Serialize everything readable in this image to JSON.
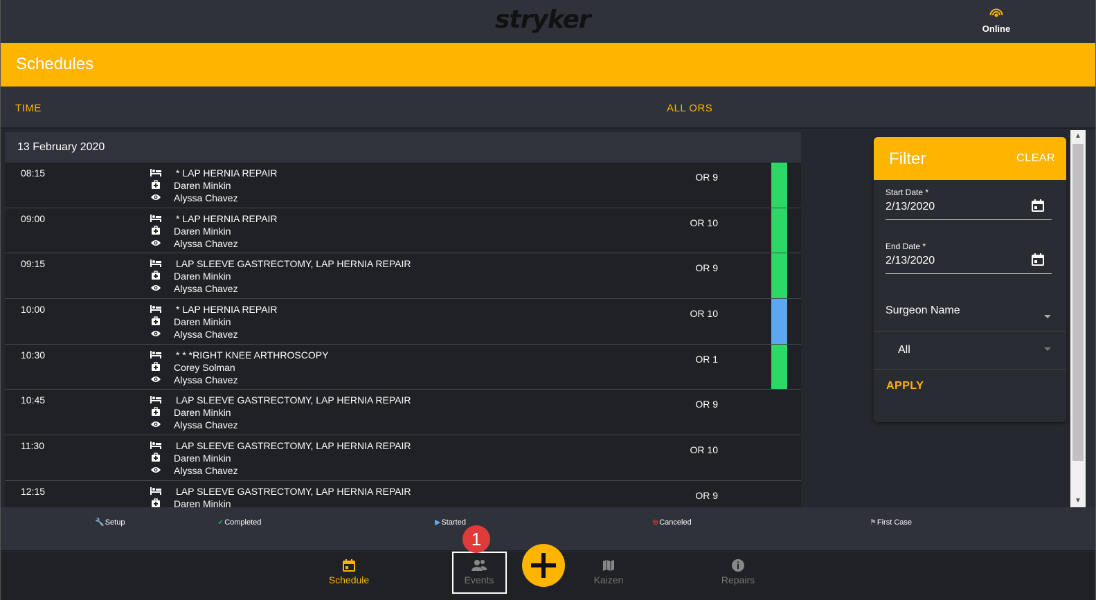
{
  "header": {
    "logo_text": "stryker",
    "status_label": "Online"
  },
  "title": "Schedules",
  "columns": {
    "time": "TIME",
    "ors": "ALL ORS"
  },
  "schedule": {
    "date": "13 February 2020",
    "rows": [
      {
        "time": "08:15",
        "procedure": " * LAP HERNIA REPAIR",
        "surgeon": "Daren Minkin",
        "observer": "Alyssa Chavez",
        "or": "OR 9",
        "status": "completed",
        "status_color": "#2ed866"
      },
      {
        "time": "09:00",
        "procedure": " * LAP HERNIA REPAIR",
        "surgeon": "Daren Minkin",
        "observer": "Alyssa Chavez",
        "or": "OR 10",
        "status": "completed",
        "status_color": "#2ed866"
      },
      {
        "time": "09:15",
        "procedure": "LAP SLEEVE GASTRECTOMY, LAP HERNIA REPAIR",
        "surgeon": "Daren Minkin",
        "observer": "Alyssa Chavez",
        "or": "OR 9",
        "status": "completed",
        "status_color": "#2ed866"
      },
      {
        "time": "10:00",
        "procedure": " * LAP HERNIA REPAIR",
        "surgeon": "Daren Minkin",
        "observer": "Alyssa Chavez",
        "or": "OR 10",
        "status": "started",
        "status_color": "#5aa9f0"
      },
      {
        "time": "10:30",
        "procedure": "* * *RIGHT KNEE ARTHROSCOPY",
        "surgeon": "Corey Solman",
        "observer": "Alyssa Chavez",
        "or": "OR 1",
        "status": "completed",
        "status_color": "#2ed866"
      },
      {
        "time": "10:45",
        "procedure": "LAP SLEEVE GASTRECTOMY, LAP HERNIA REPAIR",
        "surgeon": "Daren Minkin",
        "observer": "Alyssa Chavez",
        "or": "OR 9",
        "status": "none",
        "status_color": ""
      },
      {
        "time": "11:30",
        "procedure": "LAP SLEEVE GASTRECTOMY, LAP HERNIA REPAIR",
        "surgeon": "Daren Minkin",
        "observer": "Alyssa Chavez",
        "or": "OR 10",
        "status": "none",
        "status_color": ""
      },
      {
        "time": "12:15",
        "procedure": "LAP SLEEVE GASTRECTOMY, LAP HERNIA REPAIR",
        "surgeon": "Daren Minkin",
        "observer": "",
        "or": "OR 9",
        "status": "none",
        "status_color": ""
      }
    ]
  },
  "filter": {
    "title": "Filter",
    "clear_label": "CLEAR",
    "start_date_label": "Start Date *",
    "start_date_value": "2/13/2020",
    "end_date_label": "End Date *",
    "end_date_value": "2/13/2020",
    "surgeon_label": "Surgeon Name",
    "surgeon_value": "All",
    "apply_label": "APPLY"
  },
  "legend": {
    "setup": "Setup",
    "completed": "Completed",
    "started": "Started",
    "canceled": "Canceled",
    "first_case": "First Case"
  },
  "nav": {
    "schedule": "Schedule",
    "events": "Events",
    "kaizen": "Kaizen",
    "repairs": "Repairs",
    "badge": "1"
  },
  "colors": {
    "accent": "#ffb400",
    "completed": "#2ed866",
    "started": "#5aa9f0",
    "canceled": "#e03b3b"
  }
}
